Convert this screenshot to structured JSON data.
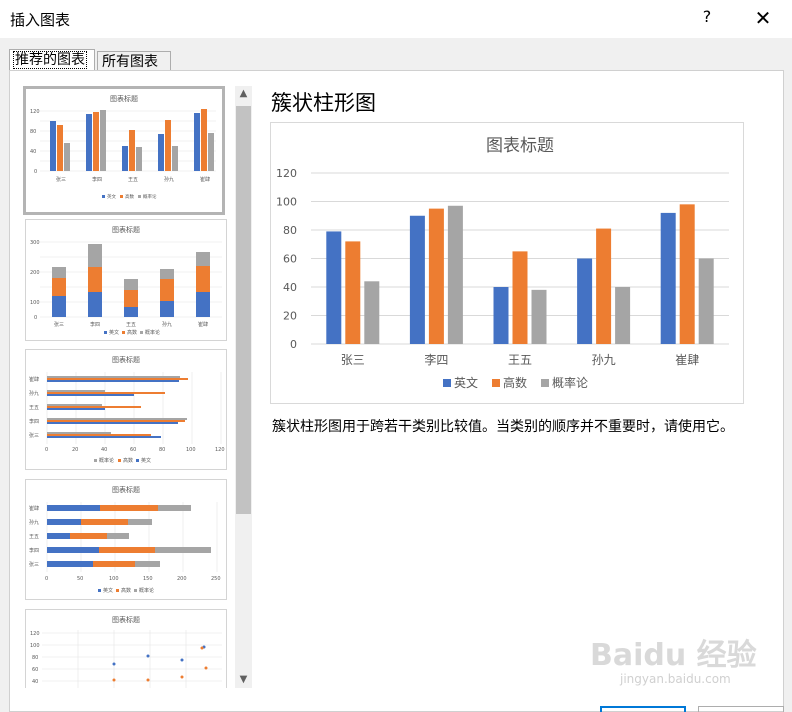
{
  "window": {
    "title": "插入图表",
    "help": "?",
    "close": "✕"
  },
  "tabs": [
    {
      "label": "推荐的图表"
    },
    {
      "label": "所有图表"
    }
  ],
  "selected_chart": {
    "name": "簇状柱形图",
    "description": "簇状柱形图用于跨若干类别比较值。当类别的顺序并不重要时，请使用它。"
  },
  "thumbnails": [
    {
      "title": "图表标题",
      "kind": "clustered-column"
    },
    {
      "title": "图表标题",
      "kind": "stacked-column"
    },
    {
      "title": "图表标题",
      "kind": "clustered-bar"
    },
    {
      "title": "图表标题",
      "kind": "stacked-bar"
    },
    {
      "title": "图表标题",
      "kind": "scatter"
    }
  ],
  "scroll": {
    "up": "▲",
    "down": "▼"
  },
  "colors": {
    "series1": "#4472c4",
    "series2": "#ed7d31",
    "series3": "#a5a5a5",
    "grid": "#d9d9d9",
    "text": "#595959"
  },
  "watermark": {
    "logo": "Baidu 经验",
    "url": "jingyan.baidu.com"
  },
  "chart_data": {
    "type": "bar",
    "title": "图表标题",
    "categories": [
      "张三",
      "李四",
      "王五",
      "孙九",
      "崔肆"
    ],
    "series": [
      {
        "name": "英文",
        "values": [
          79,
          90,
          40,
          60,
          92
        ]
      },
      {
        "name": "高数",
        "values": [
          72,
          95,
          65,
          81,
          98
        ]
      },
      {
        "name": "概率论",
        "values": [
          44,
          97,
          38,
          40,
          60
        ]
      }
    ],
    "ylim": [
      0,
      120
    ],
    "yticks": [
      0,
      20,
      40,
      60,
      80,
      100,
      120
    ],
    "grid": true,
    "legend": "bottom"
  }
}
